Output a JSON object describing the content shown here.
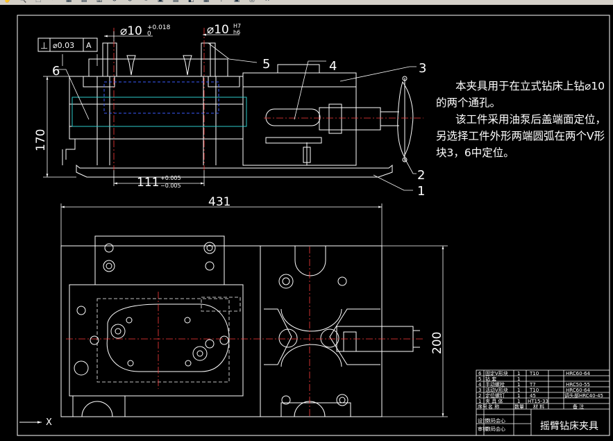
{
  "toolbar": {
    "icons": [
      "pan-icon",
      "zoom-icon",
      "zoom-window-icon",
      "zoom-previous-icon",
      "properties-icon",
      "design-center-icon",
      "tool-palette-icon",
      "undo-icon",
      "redo-icon",
      "match-properties-icon",
      "block-editor-icon",
      "tablet-icon",
      "layer-icon",
      "calculator-icon",
      "help-icon",
      "save-icon",
      "plot-icon",
      "dimension-icon"
    ],
    "glyphs": [
      "✋",
      "🔍",
      "⬚",
      "↶",
      "▦",
      "▤",
      "▥",
      "↺",
      "↻",
      "✎",
      "▣",
      "▤",
      "◧",
      "▦",
      "?",
      "▣",
      "⎙",
      "↔"
    ]
  },
  "drawing": {
    "tolerance_frame": {
      "symbol": "⊥",
      "value": "⌀0.03",
      "datum": "A"
    },
    "dims": {
      "hole_a": "⌀10",
      "hole_a_upper": "+0.018",
      "hole_a_lower": "0",
      "hole_b": "⌀10",
      "hole_b_fit_upper": "H7",
      "hole_b_fit_lower": "h6",
      "height": "170",
      "center": "111",
      "center_upper": "+0.005",
      "center_lower": "−0.005",
      "width": "431",
      "depth": "200"
    },
    "balloons": [
      "1",
      "2",
      "3",
      "4",
      "5",
      "6"
    ]
  },
  "note": {
    "line1": "本夹具用于在立式钻床上钻⌀10的两个通孔。",
    "line2": "该工件采用油泵后盖端面定位，另选择工件外形两端圆弧在两个V形块3，6中定位。"
  },
  "title_block": {
    "title": "摇臂钻床夹具",
    "rows": [
      {
        "no": "6",
        "name": "固定V形块",
        "qty": "1",
        "mat": "T10",
        "note": "HRC60-64"
      },
      {
        "no": "5",
        "name": "钻  套",
        "qty": "1",
        "mat": "",
        "note": ""
      },
      {
        "no": "4",
        "name": "手动螺栓",
        "qty": "1",
        "mat": "T7",
        "note": "HRC50-55"
      },
      {
        "no": "3",
        "name": "活动V形块",
        "qty": "1",
        "mat": "T10",
        "note": "HRC60-64"
      },
      {
        "no": "2",
        "name": "定位螺钉",
        "qty": "1",
        "mat": "45",
        "note": "调头部HRC40-45"
      },
      {
        "no": "1",
        "name": "夹 具 体",
        "qty": "1",
        "mat": "HT15-33",
        "note": ""
      }
    ],
    "header": {
      "no": "序号",
      "name": "名 称",
      "qty": "数量",
      "mat": "材 料",
      "note": "备 注"
    },
    "sign": [
      "设计",
      "审核"
    ],
    "sign_role": "数码会心"
  },
  "ucs": {
    "x_label": "X"
  },
  "colors": {
    "background": "#000000",
    "line": "#ffffff",
    "center_line": "#ff3b3b",
    "hidden_blue": "#3d5cff",
    "hidden_cyan": "#2ecccc",
    "toolbar": "#d4d0c8"
  }
}
